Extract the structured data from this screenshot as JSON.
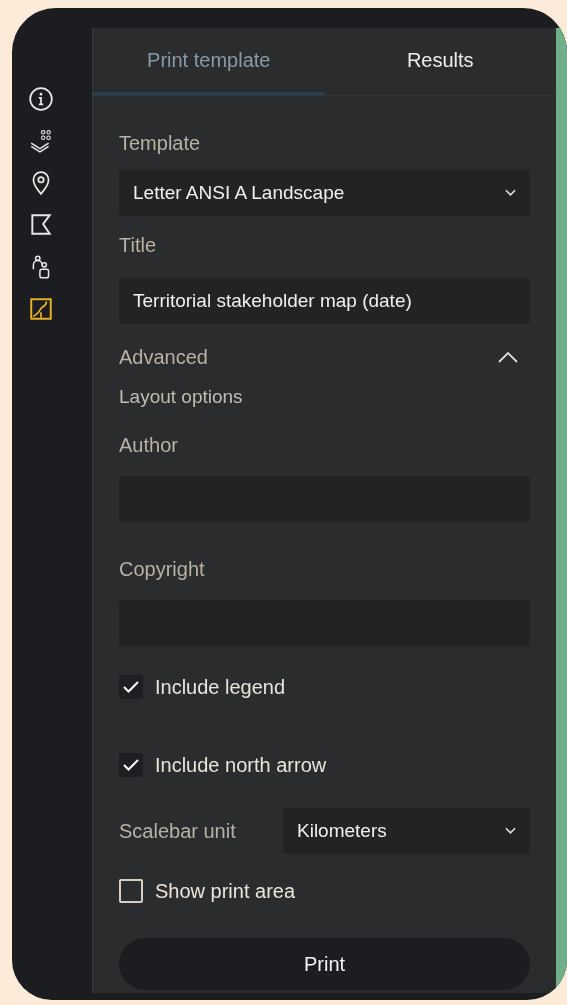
{
  "rail": [
    {
      "kind": "info",
      "selected": false
    },
    {
      "kind": "layers",
      "selected": false
    },
    {
      "kind": "pin",
      "selected": false
    },
    {
      "kind": "shape",
      "selected": false
    },
    {
      "kind": "people",
      "selected": false
    },
    {
      "kind": "print",
      "selected": true
    }
  ],
  "tabs": [
    {
      "label": "Print template",
      "selected": true
    },
    {
      "label": "Results",
      "selected": false
    }
  ],
  "template": {
    "label": "Template",
    "value": "Letter ANSI A Landscape"
  },
  "title": {
    "label": "Title",
    "value": "Territorial stakeholder map (date)"
  },
  "advanced": {
    "label": "Advanced",
    "expanded": true,
    "subheading": "Layout options",
    "fields": [
      {
        "label": "Author"
      },
      {
        "label": "Copyright"
      }
    ],
    "checkboxes": [
      {
        "label": "Include legend",
        "checked": true
      },
      {
        "label": "Include north arrow",
        "checked": true
      }
    ],
    "scalebar": {
      "label": "Scalebar unit",
      "value": "Kilometers"
    }
  },
  "show_print_area": {
    "label": "Show print area",
    "checked": false
  },
  "print_button": "Print"
}
